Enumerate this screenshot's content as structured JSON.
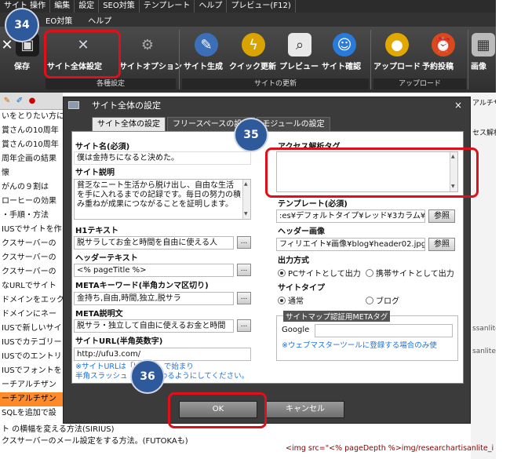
{
  "menubar": {
    "items": [
      "サイト 操作",
      "編集",
      "設定",
      "SEO対策",
      "テンプレート",
      "ヘルプ",
      "プレビュー(F12)"
    ],
    "items2": [
      "EO対策",
      "ヘルプ"
    ]
  },
  "ribbon": {
    "buttons": {
      "save": "保存",
      "site_settings": "サイト全体設定",
      "site_options": "サイトオプション",
      "site_generate": "サイト生成",
      "quick_update": "クイック更新",
      "preview": "プレビュー",
      "site_check": "サイト確認",
      "upload": "アップロード",
      "scheduled_post": "予約投稿",
      "image": "画像"
    },
    "groups": {
      "basic": "各種設定",
      "update": "サイトの更新",
      "upload": "アップロード"
    }
  },
  "left_panel": {
    "items": [
      "いをとりたい方に",
      "賞さんの10周年",
      "賞さんの10周年",
      "周年企画の結果",
      "懐",
      "がんの９割は",
      "ローヒーの効果",
      "・手順・方法",
      "IUSでサイトを作",
      "クスサーバーの",
      "クスサーバーの",
      "クスサーバーの",
      "なURLでサイト",
      "ドメインをエック",
      "ドメインにネー",
      "IUSで新しいサイ",
      "IUSでカテゴリー",
      "IUSでのエントリ",
      "IUSでフォントを",
      "ーチアルチザン",
      "ーチアルチザン",
      "SQLを追加で設"
    ],
    "selected_index": 20
  },
  "bottom_left": {
    "rows": [
      "ト の横幅を変える方法(SIRIUS)",
      "クスサーバーのメール設定をする方法。(FUTOKAも)"
    ]
  },
  "right_panel": {
    "texts": [
      "アルチザ",
      "セス解析号",
      "ssanlite_i",
      "sanlite_i",
      "researchartisanlite_i"
    ],
    "code": "<img src=\"<% pageDepth %>img/researchartisanlite_i"
  },
  "dialog": {
    "title": "サイト全体の設定",
    "close": "×",
    "tabs": [
      "サイト全体の設定",
      "フリースペースの設定",
      "モジュールの設定"
    ],
    "site_name_label": "サイト名(必須)",
    "site_name_value": "僕は金持ちになると決めた。",
    "site_desc_label": "サイト説明",
    "site_desc_value": "貧乏なニート生活から脱け出し、自由な生活を手に入れるまでの記録です。毎日の努力の積み重ねが成果につながることを証明します。",
    "h1_label": "H1テキスト",
    "h1_value": "脱サラしてお金と時間を自由に使える人",
    "header_text_label": "ヘッダーテキスト",
    "header_text_value": "<% pageTitle %>",
    "meta_kw_label": "METAキーワード(半角カンマ区切り)",
    "meta_kw_value": "金持ち,自由,時間,独立,脱サラ",
    "meta_desc_label": "META説明文",
    "meta_desc_value": "脱サラ・独立して自由に使えるお金と時間",
    "site_url_label": "サイトURL(半角英数字)",
    "site_url_value": "http://ufu3.com/",
    "url_hint_1": "※サイトURLは「http://」で始まり",
    "url_hint_2": "半角スラッシュ「/」で終わるようにしてください。",
    "analytics_label": "アクセス解析タグ",
    "analytics_value": "",
    "template_label": "テンプレート(必須)",
    "template_value": ":es¥デフォルトタイプ¥レッド¥3カラム¥",
    "header_image_label": "ヘッダー画像",
    "header_image_value": "フィリエイト¥画像¥blog¥header02.jpg",
    "browse": "参照",
    "output_label": "出力方式",
    "output_pc": "PCサイトとして出力",
    "output_mobile": "携帯サイトとして出力",
    "site_type_label": "サイトタイプ",
    "site_type_normal": "通常",
    "site_type_blog": "ブログ",
    "sitemap_legend": "サイトマップ認証用METAタグ",
    "google_label": "Google",
    "sitemap_hint": "※ウェブマスターツールに登録する場合のみ使",
    "ok": "OK",
    "cancel": "キャンセル",
    "dots": "..."
  },
  "annotations": {
    "m34": "34",
    "m35": "35",
    "m36": "36",
    "highlight_color": "#e0101a",
    "marker_color": "#2e5a9c"
  }
}
